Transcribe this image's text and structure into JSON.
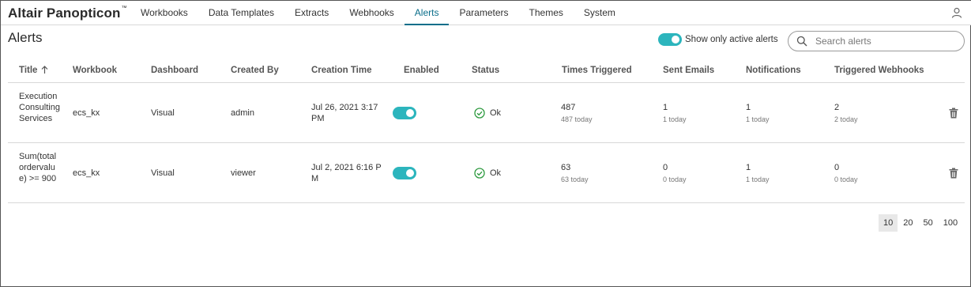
{
  "app": {
    "logo": "Altair Panopticon",
    "logo_mark": "™"
  },
  "nav": {
    "items": [
      {
        "label": "Workbooks"
      },
      {
        "label": "Data Templates"
      },
      {
        "label": "Extracts"
      },
      {
        "label": "Webhooks"
      },
      {
        "label": "Alerts",
        "active": true
      },
      {
        "label": "Parameters"
      },
      {
        "label": "Themes"
      },
      {
        "label": "System"
      }
    ]
  },
  "page": {
    "title": "Alerts"
  },
  "filter": {
    "active_only_label": "Show only active alerts",
    "active_only_on": true
  },
  "search": {
    "placeholder": "Search alerts",
    "value": ""
  },
  "table": {
    "columns": {
      "title": "Title",
      "workbook": "Workbook",
      "dashboard": "Dashboard",
      "created_by": "Created By",
      "creation_time": "Creation Time",
      "enabled": "Enabled",
      "status": "Status",
      "times_triggered": "Times Triggered",
      "sent_emails": "Sent Emails",
      "notifications": "Notifications",
      "triggered_webhooks": "Triggered Webhooks"
    },
    "sort": {
      "column": "title",
      "direction": "ascending"
    },
    "rows": [
      {
        "title": "Execution Consulting Services",
        "workbook": "ecs_kx",
        "dashboard": "Visual",
        "created_by": "admin",
        "creation_time": "Jul 26, 2021 3:17 PM",
        "enabled": true,
        "status": "Ok",
        "times_triggered": "487",
        "times_triggered_today": "487 today",
        "sent_emails": "1",
        "sent_emails_today": "1 today",
        "notifications": "1",
        "notifications_today": "1 today",
        "triggered_webhooks": "2",
        "triggered_webhooks_today": "2 today"
      },
      {
        "title": "Sum(totalordervalue) >= 900",
        "workbook": "ecs_kx",
        "dashboard": "Visual",
        "created_by": "viewer",
        "creation_time": "Jul 2, 2021 6:16 PM",
        "enabled": true,
        "status": "Ok",
        "times_triggered": "63",
        "times_triggered_today": "63 today",
        "sent_emails": "0",
        "sent_emails_today": "0 today",
        "notifications": "1",
        "notifications_today": "1 today",
        "triggered_webhooks": "0",
        "triggered_webhooks_today": "0 today"
      }
    ]
  },
  "pager": {
    "sizes": [
      "10",
      "20",
      "50",
      "100"
    ],
    "selected": "10"
  },
  "colors": {
    "accent": "#0a6e8a",
    "toggle_on": "#2cb5bd",
    "status_ok": "#2e9a3f"
  },
  "icons": {
    "user": "user-icon",
    "search": "search-icon",
    "sort": "arrow-up-icon",
    "status": "check-circle-icon",
    "delete": "trash-icon"
  }
}
